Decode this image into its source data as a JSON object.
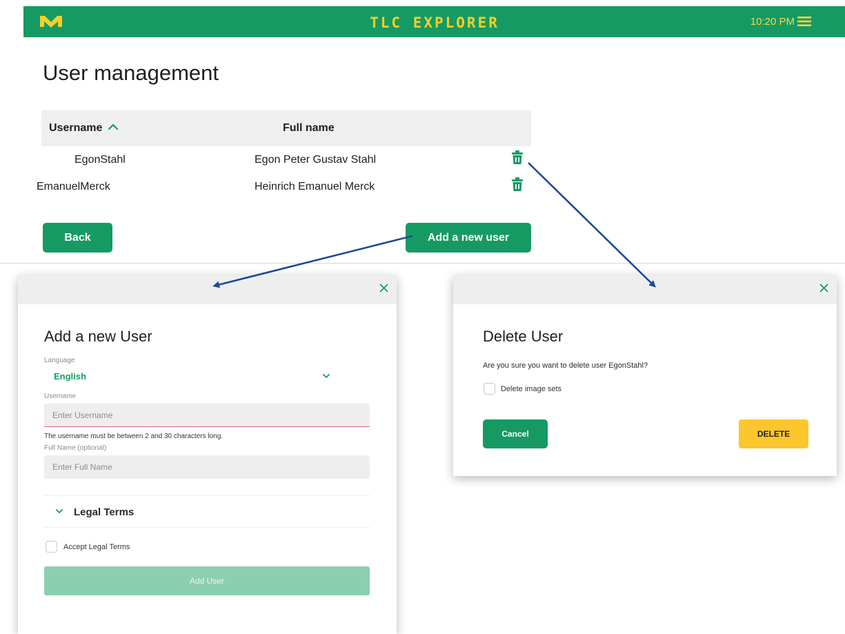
{
  "app": {
    "title": "TLC EXPLORER",
    "time": "10:20 PM",
    "logo_icon": "m-logo-icon",
    "accent": "#169a63",
    "title_color": "#f5cf2c"
  },
  "page": {
    "title": "User management"
  },
  "table": {
    "headers": {
      "username": "Username",
      "full_name": "Full name"
    },
    "sort": "ascending",
    "rows": [
      {
        "username": "EgonStahl",
        "full_name": "Egon Peter Gustav Stahl"
      },
      {
        "username": "EmanuelMerck",
        "full_name": "Heinrich Emanuel Merck"
      }
    ]
  },
  "buttons": {
    "back": "Back",
    "add_new_user": "Add a new user"
  },
  "add_dialog": {
    "title": "Add a new User",
    "language_label": "Language",
    "language_value": "English",
    "username_label": "Username",
    "username_placeholder": "Enter Username",
    "username_error": "The username must be between 2 and 30 characters long.",
    "fullname_label": "Full Name (optional)",
    "fullname_placeholder": "Enter Full Name",
    "legal_terms": "Legal Terms",
    "accept_legal": "Accept Legal Terms",
    "submit": "Add User"
  },
  "delete_dialog": {
    "title": "Delete User",
    "question": "Are you sure you want to delete user EgonStahl?",
    "delete_images": "Delete image sets",
    "cancel": "Cancel",
    "delete": "DELETE",
    "delete_color": "#fcc72c"
  }
}
